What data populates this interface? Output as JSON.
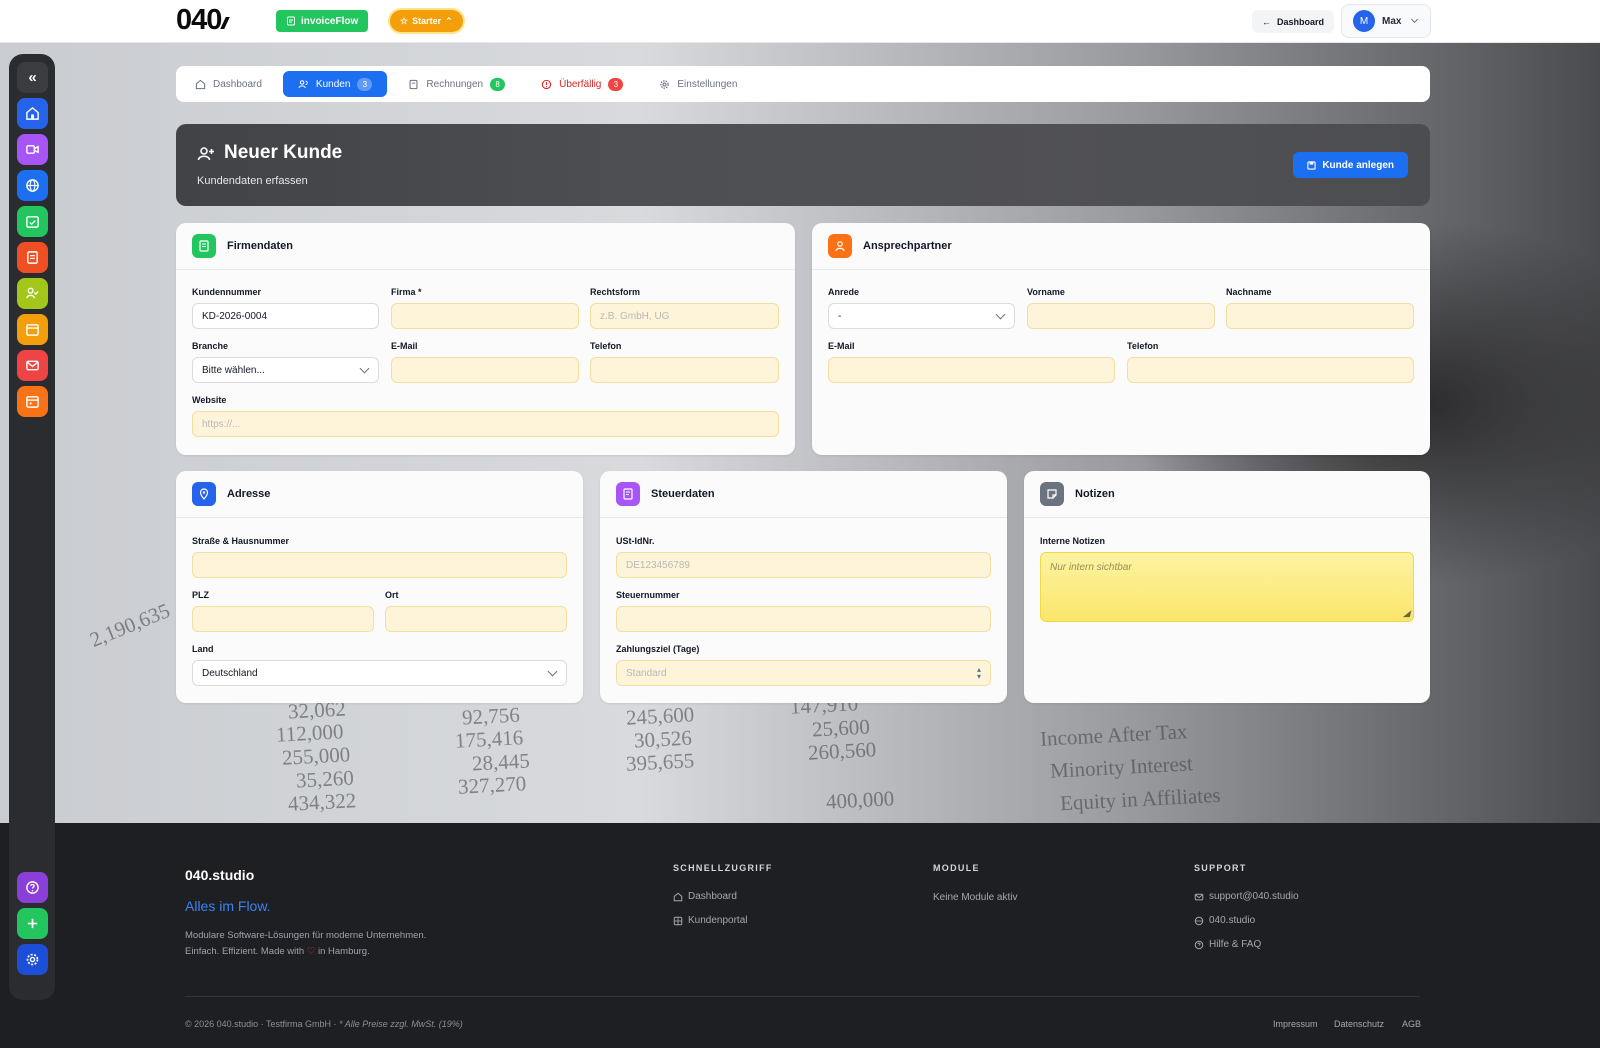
{
  "topbar": {
    "logo": "040",
    "app_name": "invoiceFlow",
    "plan": "Starter",
    "back_label": "Dashboard",
    "user_initial": "M",
    "user_name": "Max"
  },
  "tabs": [
    {
      "label": "Dashboard",
      "badge": ""
    },
    {
      "label": "Kunden",
      "badge": "3"
    },
    {
      "label": "Rechnungen",
      "badge": "8"
    },
    {
      "label": "Überfällig",
      "badge": "3"
    },
    {
      "label": "Einstellungen",
      "badge": ""
    }
  ],
  "colors": {
    "accent": "#1d6ff2",
    "badge_green": "#22c55e",
    "badge_red": "#ef4444",
    "field_fill": "#fdf4d9"
  },
  "header": {
    "title": "Neuer Kunde",
    "subtitle": "Kundendaten erfassen",
    "save_label": "Kunde anlegen"
  },
  "firmendaten": {
    "title": "Firmendaten",
    "kundennummer_label": "Kundennummer",
    "kundennummer_value": "KD-2026-0004",
    "firma_label": "Firma *",
    "rechtsform_label": "Rechtsform",
    "rechtsform_placeholder": "z.B. GmbH, UG",
    "branche_label": "Branche",
    "branche_value": "Bitte wählen...",
    "email_label": "E-Mail",
    "telefon_label": "Telefon",
    "website_label": "Website",
    "website_placeholder": "https://..."
  },
  "ansprechpartner": {
    "title": "Ansprechpartner",
    "anrede_label": "Anrede",
    "anrede_value": "-",
    "vorname_label": "Vorname",
    "nachname_label": "Nachname",
    "email_label": "E-Mail",
    "telefon_label": "Telefon"
  },
  "adresse": {
    "title": "Adresse",
    "strasse_label": "Straße & Hausnummer",
    "plz_label": "PLZ",
    "ort_label": "Ort",
    "land_label": "Land",
    "land_value": "Deutschland"
  },
  "steuerdaten": {
    "title": "Steuerdaten",
    "ustid_label": "USt-IdNr.",
    "ustid_placeholder": "DE123456789",
    "steuernummer_label": "Steuernummer",
    "zahlungsziel_label": "Zahlungsziel (Tage)",
    "zahlungsziel_placeholder": "Standard"
  },
  "notizen": {
    "title": "Notizen",
    "interne_label": "Interne Notizen",
    "interne_placeholder": "Nur intern sichtbar"
  },
  "footer": {
    "brand": "040.studio",
    "tagline": "Alles im Flow.",
    "desc_line1": "Modulare Software-Lösungen für moderne Unternehmen.",
    "desc_line2_a": "Einfach. Effizient. Made with",
    "desc_line2_b": "in Hamburg.",
    "schnellzugriff_title": "SCHNELLZUGRIFF",
    "schnellzugriff_links": [
      "Dashboard",
      "Kundenportal"
    ],
    "module_title": "MODULE",
    "module_text": "Keine Module aktiv",
    "support_title": "SUPPORT",
    "support_links": [
      "support@040.studio",
      "040.studio",
      "Hilfe & FAQ"
    ],
    "copyright": "© 2026 040.studio · Testfirma GmbH ·",
    "copyright_note": "* Alle Preise zzgl. MwSt. (19%)",
    "legal": [
      "Impressum",
      "Datenschutz",
      "AGB"
    ]
  },
  "background_numbers": [
    "2,190,635",
    "32,062",
    "112,000",
    "255,000",
    "35,260",
    "434,322",
    "92,756",
    "175,416",
    "28,445",
    "327,270",
    "245,600",
    "30,526",
    "395,655",
    "147,910",
    "25,600",
    "260,560",
    "400,000",
    "Income After Tax",
    "Minority Interest",
    "Equity in Affiliates"
  ]
}
